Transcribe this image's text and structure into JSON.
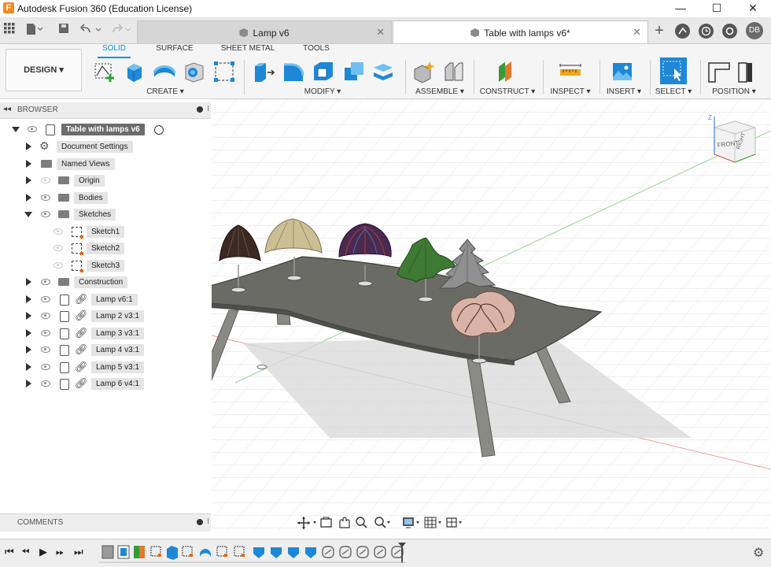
{
  "window": {
    "title": "Autodesk Fusion 360 (Education License)",
    "logo_letter": "F",
    "minimize": "—",
    "maximize": "☐",
    "close": "✕"
  },
  "tabs": [
    {
      "label": "Lamp v6",
      "active": false
    },
    {
      "label": "Table with lamps v6*",
      "active": true
    }
  ],
  "user_initials": "DB",
  "toolbar": {
    "design_label": "DESIGN ▾",
    "workspace_tabs": [
      "SOLID",
      "SURFACE",
      "SHEET METAL",
      "TOOLS"
    ],
    "groups": [
      "CREATE ▾",
      "MODIFY ▾",
      "ASSEMBLE ▾",
      "CONSTRUCT ▾",
      "INSPECT ▾",
      "INSERT ▾",
      "SELECT ▾",
      "POSITION ▾"
    ]
  },
  "browser": {
    "title": "BROWSER",
    "root": "Table with lamps v6",
    "items": [
      {
        "label": "Document Settings"
      },
      {
        "label": "Named Views"
      },
      {
        "label": "Origin"
      },
      {
        "label": "Bodies"
      },
      {
        "label": "Sketches"
      },
      {
        "label": "Sketch1"
      },
      {
        "label": "Sketch2"
      },
      {
        "label": "Sketch3"
      },
      {
        "label": "Construction"
      },
      {
        "label": "Lamp v6:1"
      },
      {
        "label": "Lamp 2 v3:1"
      },
      {
        "label": "Lamp 3 v3:1"
      },
      {
        "label": "Lamp 4 v3:1"
      },
      {
        "label": "Lamp 5 v3:1"
      },
      {
        "label": "Lamp 6 v4:1"
      }
    ]
  },
  "viewcube": {
    "front": "FRONT",
    "right": "RIGHT",
    "z": "Z"
  },
  "comments": {
    "title": "COMMENTS"
  },
  "colors": {
    "accent": "#0696d7",
    "table_top": "#6b6b66",
    "lamp1": "#3a2a22",
    "lamp2": "#cbbf94",
    "lamp3": "#4a2a4f",
    "lamp4": "#3f7a35",
    "lamp5": "#909090",
    "lamp6": "#d9b3a6"
  }
}
